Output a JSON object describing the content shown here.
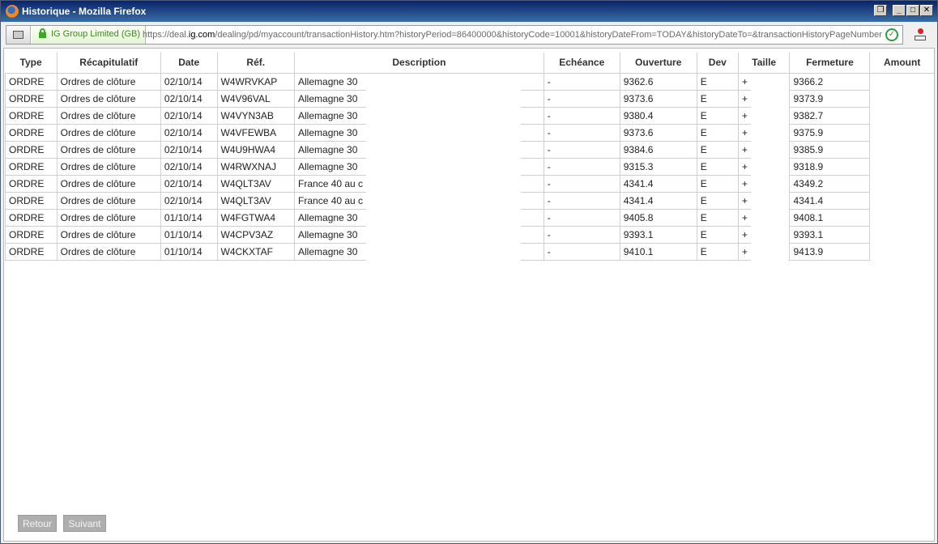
{
  "window": {
    "title": "Historique - Mozilla Firefox",
    "controls": [
      "restore",
      "minimize",
      "maximize",
      "close"
    ]
  },
  "urlbar": {
    "identity": "IG Group Limited (GB)",
    "url_prefix": "https://deal.",
    "url_domain": "ig.com",
    "url_rest": "/dealing/pd/myaccount/transactionHistory.htm?historyPeriod=86400000&historyCode=10001&historyDateFrom=TODAY&historyDateTo=&transactionHistoryPageNumber"
  },
  "table": {
    "headers": {
      "type": "Type",
      "recap": "Récapitulatif",
      "date": "Date",
      "ref": "Réf.",
      "description": "Description",
      "echeance": "Echéance",
      "ouverture": "Ouverture",
      "dev": "Dev",
      "taille": "Taille",
      "fermeture": "Fermeture",
      "amount": "Amount"
    },
    "rows": [
      {
        "type": "ORDRE",
        "recap": "Ordres de clôture",
        "date": "02/10/14",
        "ref": "W4WRVKAP",
        "description": "Allemagne 30",
        "echeance": "-",
        "ouverture": "9362.6",
        "dev": "E",
        "taille": "+",
        "fermeture": "9366.2"
      },
      {
        "type": "ORDRE",
        "recap": "Ordres de clôture",
        "date": "02/10/14",
        "ref": "W4V96VAL",
        "description": "Allemagne 30",
        "echeance": "-",
        "ouverture": "9373.6",
        "dev": "E",
        "taille": "+",
        "fermeture": "9373.9"
      },
      {
        "type": "ORDRE",
        "recap": "Ordres de clôture",
        "date": "02/10/14",
        "ref": "W4VYN3AB",
        "description": "Allemagne 30",
        "echeance": "-",
        "ouverture": "9380.4",
        "dev": "E",
        "taille": "+",
        "fermeture": "9382.7"
      },
      {
        "type": "ORDRE",
        "recap": "Ordres de clôture",
        "date": "02/10/14",
        "ref": "W4VFEWBA",
        "description": "Allemagne 30",
        "echeance": "-",
        "ouverture": "9373.6",
        "dev": "E",
        "taille": "+",
        "fermeture": "9375.9"
      },
      {
        "type": "ORDRE",
        "recap": "Ordres de clôture",
        "date": "02/10/14",
        "ref": "W4U9HWA4",
        "description": "Allemagne 30",
        "echeance": "-",
        "ouverture": "9384.6",
        "dev": "E",
        "taille": "+",
        "fermeture": "9385.9"
      },
      {
        "type": "ORDRE",
        "recap": "Ordres de clôture",
        "date": "02/10/14",
        "ref": "W4RWXNAJ",
        "description": "Allemagne 30",
        "echeance": "-",
        "ouverture": "9315.3",
        "dev": "E",
        "taille": "+",
        "fermeture": "9318.9"
      },
      {
        "type": "ORDRE",
        "recap": "Ordres de clôture",
        "date": "02/10/14",
        "ref": "W4QLT3AV",
        "description": "France 40 au c",
        "echeance": "-",
        "ouverture": "4341.4",
        "dev": "E",
        "taille": "+",
        "fermeture": "4349.2"
      },
      {
        "type": "ORDRE",
        "recap": "Ordres de clôture",
        "date": "02/10/14",
        "ref": "W4QLT3AV",
        "description": "France 40 au c",
        "echeance": "-",
        "ouverture": "4341.4",
        "dev": "E",
        "taille": "+",
        "fermeture": "4341.4"
      },
      {
        "type": "ORDRE",
        "recap": "Ordres de clôture",
        "date": "01/10/14",
        "ref": "W4FGTWA4",
        "description": "Allemagne 30",
        "echeance": "-",
        "ouverture": "9405.8",
        "dev": "E",
        "taille": "+",
        "fermeture": "9408.1"
      },
      {
        "type": "ORDRE",
        "recap": "Ordres de clôture",
        "date": "01/10/14",
        "ref": "W4CPV3AZ",
        "description": "Allemagne 30",
        "echeance": "-",
        "ouverture": "9393.1",
        "dev": "E",
        "taille": "+",
        "fermeture": "9393.1"
      },
      {
        "type": "ORDRE",
        "recap": "Ordres de clôture",
        "date": "01/10/14",
        "ref": "W4CKXTAF",
        "description": "Allemagne 30",
        "echeance": "-",
        "ouverture": "9410.1",
        "dev": "E",
        "taille": "+",
        "fermeture": "9413.9"
      }
    ]
  },
  "pagination": {
    "prev_label": "Retour",
    "next_label": "Suivant"
  }
}
